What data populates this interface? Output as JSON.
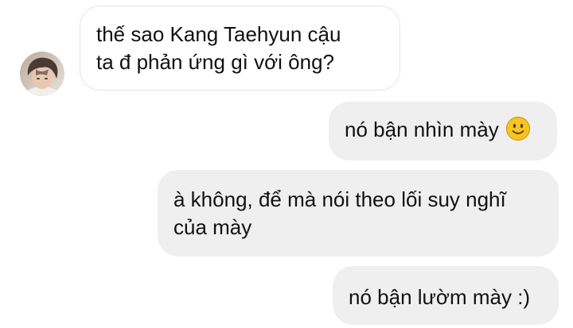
{
  "conversation": {
    "incoming": [
      {
        "lines": [
          "thế sao Kang Taehyun cậu",
          "ta đ phản ứng gì với ông?"
        ]
      }
    ],
    "outgoing": [
      {
        "lines": [
          "nó bận nhìn mày"
        ],
        "emoji": "slightly-smiling-face-icon"
      },
      {
        "lines": [
          "à không, để mà nói theo lối suy nghĩ",
          "của mày"
        ]
      },
      {
        "lines": [
          "nó bận lườm mày :)"
        ]
      }
    ]
  },
  "colors": {
    "incoming_bg": "#ffffff",
    "incoming_border": "#e4e4e4",
    "outgoing_bg": "#efefef",
    "text": "#111111",
    "emoji_yellow": "#f7c325"
  }
}
